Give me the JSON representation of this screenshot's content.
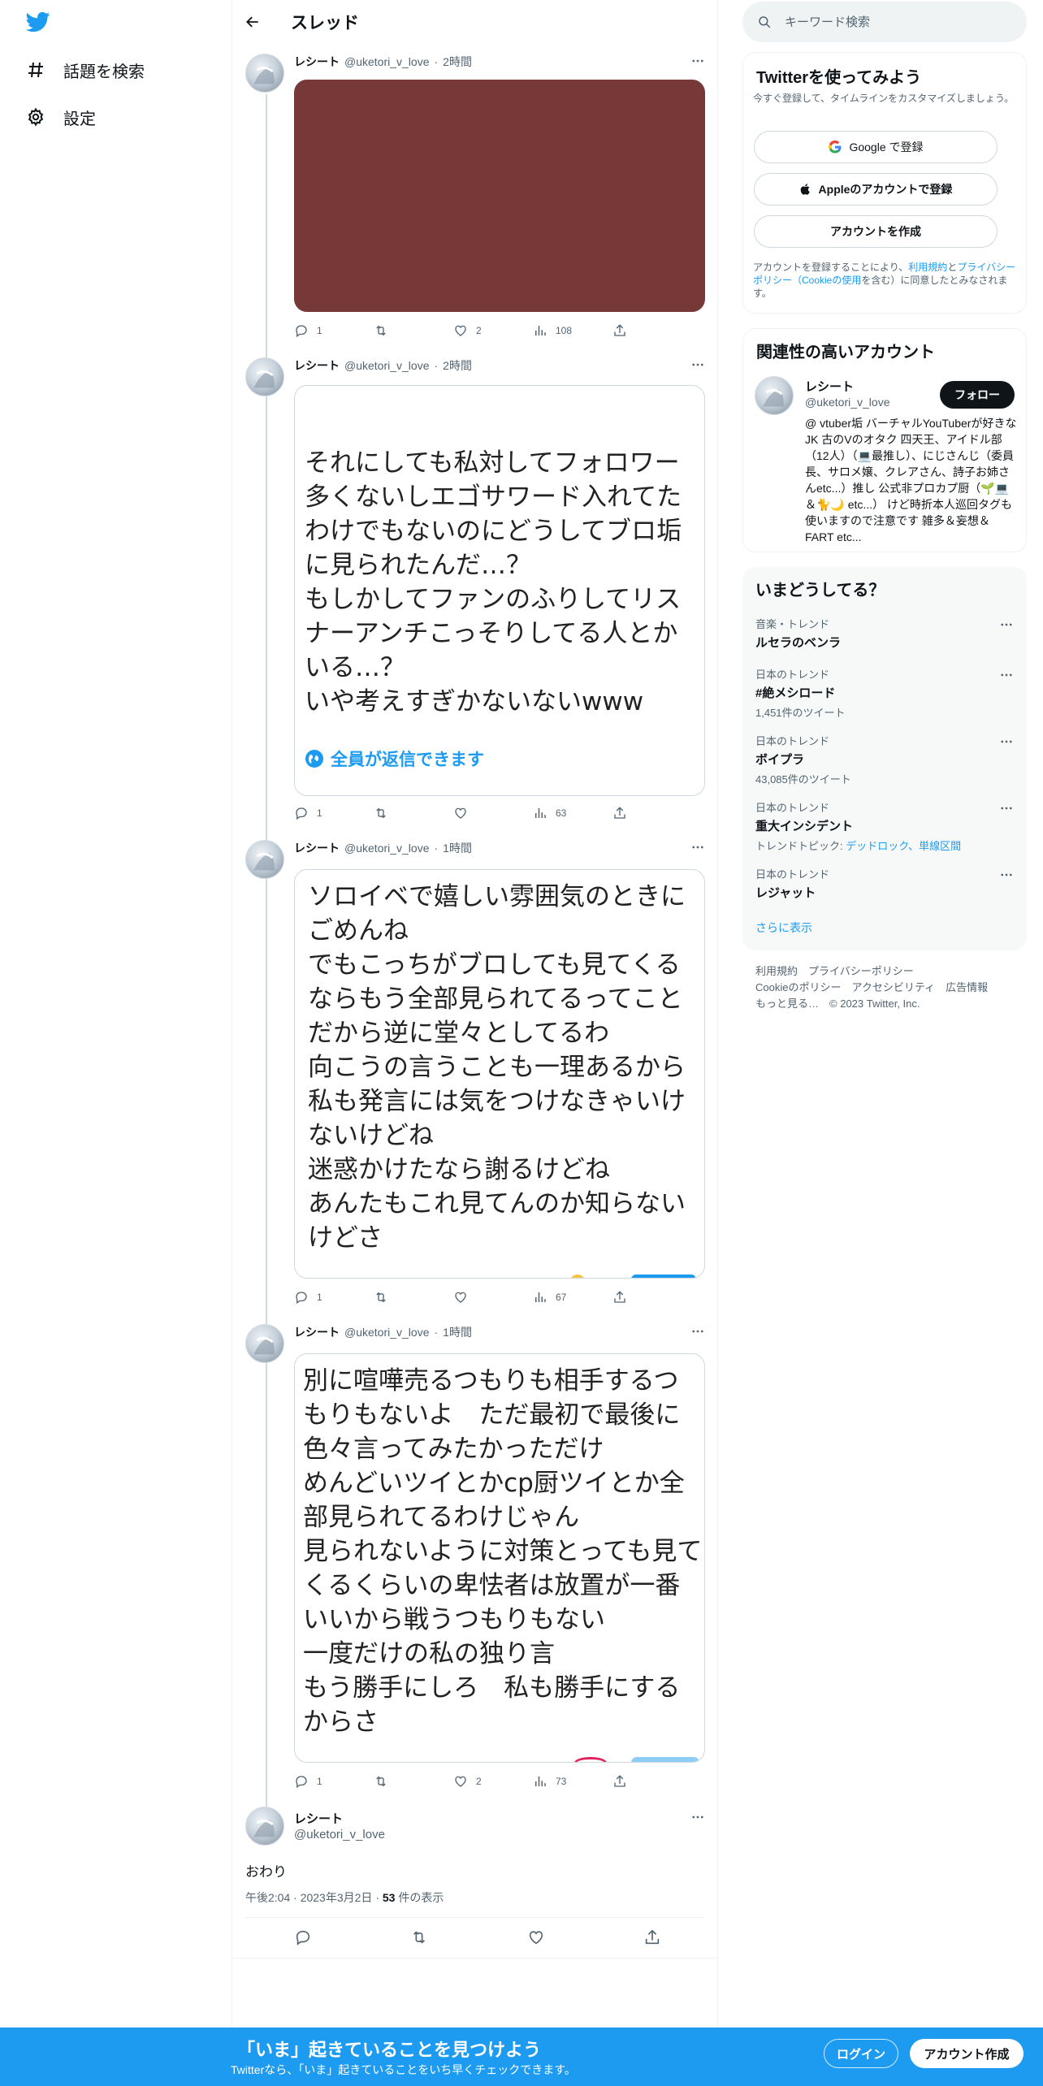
{
  "nav": {
    "logo": "twitter-bird",
    "explore_label": "話題を検索",
    "settings_label": "設定"
  },
  "header": {
    "title": "スレッド"
  },
  "tweets": [
    {
      "name": "レシート",
      "handle": "@uketori_v_love",
      "time": "2時間",
      "media_color": "#773838",
      "stats": {
        "reply": "1",
        "retweet": "",
        "like": "2",
        "views": "108"
      }
    },
    {
      "name": "レシート",
      "handle": "@uketori_v_love",
      "time": "2時間",
      "text": "それにしても私対してフォロワー多くないしエゴサワード入れてたわけでもないのにどうしてブロ垢に見られたんだ…？\nもしかしてファンのふりしてリスナーアンチこっそりしてる人とかいる…？\nいや考えすぎかないないwww",
      "reply_notice": "全員が返信できます",
      "stats": {
        "reply": "1",
        "retweet": "",
        "like": "",
        "views": "63"
      }
    },
    {
      "name": "レシート",
      "handle": "@uketori_v_love",
      "time": "1時間",
      "text": "ソロイベで嬉しい雰囲気のときにごめんね\nでもこっちがブロしても見てくるならもう全部見られてるってことだから逆に堂々としてるわ\n向こうの言うことも一理あるから私も発言には気をつけなきゃいけないけどね\n迷惑かけたなら謝るけどね\nあんたもこれ見てんのか知らないけどさ",
      "stats": {
        "reply": "1",
        "retweet": "",
        "like": "",
        "views": "67"
      }
    },
    {
      "name": "レシート",
      "handle": "@uketori_v_love",
      "time": "1時間",
      "text": "別に喧嘩売るつもりも相手するつもりもないよ　ただ最初で最後に色々言ってみたかっただけ\nめんどいツイとかcp厨ツイとか全部見られてるわけじゃん\n見られないように対策とっても見てくるくらいの卑怯者は放置が一番いいから戦うつもりもない\n一度だけの私の独り言\nもう勝手にしろ　私も勝手にするからさ",
      "stats": {
        "reply": "1",
        "retweet": "",
        "like": "2",
        "views": "73"
      }
    }
  ],
  "main_tweet": {
    "name": "レシート",
    "handle": "@uketori_v_love",
    "text": "おわり",
    "time": "午後2:04",
    "date": "2023年3月2日",
    "views_count": "53",
    "views_label": "件の表示"
  },
  "search": {
    "placeholder": "キーワード検索"
  },
  "signup_card": {
    "title": "Twitterを使ってみよう",
    "subtitle": "今すぐ登録して、タイムラインをカスタマイズしましょう。",
    "google_label": "Google で登録",
    "apple_label": "Appleのアカウントで登録",
    "create_label": "アカウントを作成",
    "legal_1": "アカウントを登録することにより、",
    "legal_terms": "利用規約",
    "legal_2": "と",
    "legal_privacy": "プライバシーポリシー（Cookieの使用",
    "legal_3": "を含む）に同意したとみなされます。"
  },
  "related": {
    "title": "関連性の高いアカウント",
    "name": "レシート",
    "handle": "@uketori_v_love",
    "follow_label": "フォロー",
    "bio": "@ vtuber垢 バーチャルYouTuberが好きなJK 古のVのオタク 四天王、アイドル部（12人）（💻最推し）、にじさんじ（委員長、サロメ嬢、クレアさん、詩子お姉さんetc...）推し 公式非プロカプ厨（🌱💻＆🐈🌙 etc...） けど時折本人巡回タグも使いますので注意です 雑多＆妄想＆FART etc..."
  },
  "trends": {
    "title": "いまどうしてる？",
    "items": [
      {
        "category": "音楽・トレンド",
        "name": "ルセラのベンラ",
        "count": ""
      },
      {
        "category": "日本のトレンド",
        "name": "#絶メシロード",
        "count": "1,451件のツイート"
      },
      {
        "category": "日本のトレンド",
        "name": "ボイプラ",
        "count": "43,085件のツイート"
      },
      {
        "category": "日本のトレンド",
        "name": "重大インシデント",
        "count": "",
        "topic_prefix": "トレンドトピック: ",
        "topic_links": "デッドロック、単線区間"
      },
      {
        "category": "日本のトレンド",
        "name": "レジャット",
        "count": ""
      }
    ],
    "show_more": "さらに表示"
  },
  "footer": {
    "line1a": "利用規約",
    "line1b": "プライバシーポリシー",
    "line2a": "Cookieのポリシー",
    "line2b": "アクセシビリティ",
    "line2c": "広告情報",
    "line3a": "もっと見る…",
    "line3b": "© 2023 Twitter, Inc."
  },
  "banner": {
    "title": "「いま」起きていることを見つけよう",
    "subtitle": "Twitterなら、「いま」起きていることをいち早くチェックできます。",
    "login_label": "ログイン",
    "signup_label": "アカウント作成"
  },
  "colors": {
    "accent": "#1d9bf0",
    "banner": "#1d9bf0",
    "media": "#773838"
  }
}
